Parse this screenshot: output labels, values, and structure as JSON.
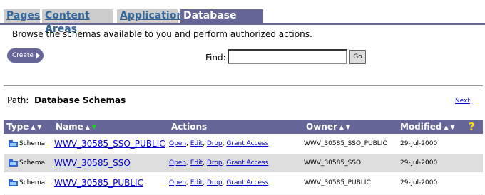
{
  "tabs": [
    {
      "label": "Pages",
      "active": false
    },
    {
      "label": "Content Areas",
      "active": false
    },
    {
      "label": "Applications",
      "active": false
    },
    {
      "label": "Database Objects",
      "active": true
    }
  ],
  "instructions": "Browse the schemas available to you and perform authorized actions.",
  "create_button": "Create",
  "find": {
    "label": "Find:",
    "value": "",
    "go_label": "Go"
  },
  "path": {
    "label": "Path:",
    "value": "Database Schemas"
  },
  "next_link": "Next",
  "table": {
    "columns": {
      "type": "Type",
      "name": "Name",
      "actions": "Actions",
      "owner": "Owner",
      "modified": "Modified"
    },
    "sorted_column": "Name",
    "sort_direction": "descending",
    "help_icon": "?",
    "rows": [
      {
        "icon": "schema-icon",
        "type": "Schema",
        "name": "WWV_30585_SSO_PUBLIC",
        "actions": [
          "Open",
          "Edit",
          "Drop",
          "Grant Access"
        ],
        "owner": "WWV_30585_SSO_PUBLIC",
        "modified": "29-Jul-2000"
      },
      {
        "icon": "schema-icon",
        "type": "Schema",
        "name": "WWV_30585_SSO",
        "actions": [
          "Open",
          "Edit",
          "Drop",
          "Grant Access"
        ],
        "owner": "WWV_30585_SSO",
        "modified": "29-Jul-2000"
      },
      {
        "icon": "schema-icon",
        "type": "Schema",
        "name": "WWV_30585_PUBLIC",
        "actions": [
          "Open",
          "Edit",
          "Drop",
          "Grant Access"
        ],
        "owner": "WWV_30585_PUBLIC",
        "modified": "29-Jul-2000"
      }
    ]
  },
  "colors": {
    "accent": "#666699",
    "tab_inactive_bg": "#cccccc",
    "tab_inactive_text": "#336699",
    "link": "#0000cc",
    "row_alt": "#dddddd",
    "help": "#ffdd00"
  }
}
